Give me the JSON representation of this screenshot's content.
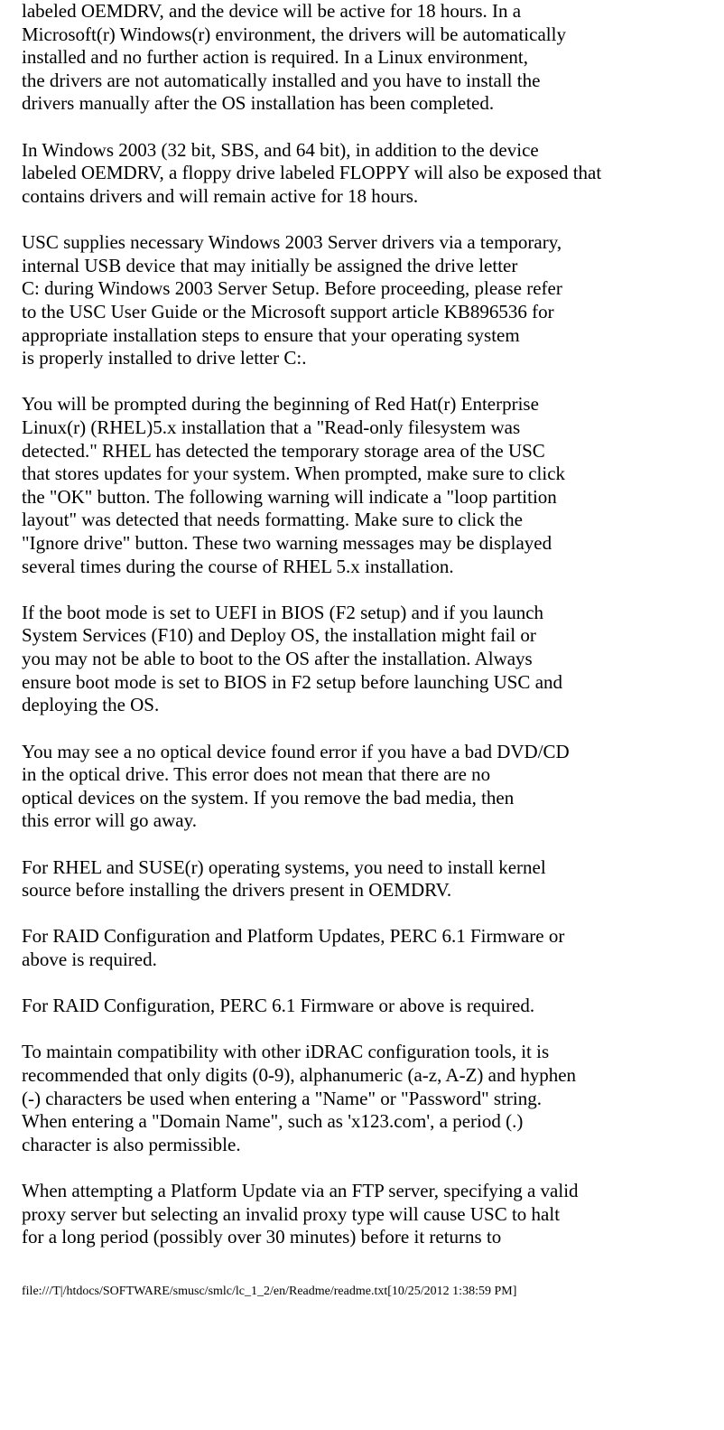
{
  "body_text": "labeled OEMDRV, and the device will be active for 18 hours. In a\nMicrosoft(r) Windows(r) environment, the drivers will be automatically\ninstalled and no further action is required. In a Linux environment,\nthe drivers are not automatically installed and you have to install the\ndrivers manually after the OS installation has been completed.\n\nIn Windows 2003 (32 bit, SBS, and 64 bit), in addition to the device\nlabeled OEMDRV, a floppy drive labeled FLOPPY will also be exposed that\ncontains drivers and will remain active for 18 hours.\n\nUSC supplies necessary Windows 2003 Server drivers via a temporary,\ninternal USB device that may initially be assigned the drive letter\nC: during Windows 2003 Server Setup. Before proceeding, please refer\nto the USC User Guide or the Microsoft support article KB896536 for\nappropriate installation steps to ensure that your operating system\nis properly installed to drive letter C:.\n\nYou will be prompted during the beginning of Red Hat(r) Enterprise\nLinux(r) (RHEL)5.x installation that a \"Read-only filesystem was\ndetected.\" RHEL has detected the temporary storage area of the USC\nthat stores updates for your system. When prompted, make sure to click\nthe \"OK\" button. The following warning will indicate a \"loop partition\nlayout\" was detected that needs formatting. Make sure to click the\n\"Ignore drive\" button. These two warning messages may be displayed\nseveral times during the course of RHEL 5.x installation.\n\nIf the boot mode is set to UEFI in BIOS (F2 setup) and if you launch\nSystem Services (F10) and Deploy OS, the installation might fail or\nyou may not be able to boot to the OS after the installation. Always\nensure boot mode is set to BIOS in F2 setup before launching USC and\ndeploying the OS.\n\nYou may see a no optical device found error if you have a bad DVD/CD\nin the optical drive. This error does not mean that there are no\noptical devices on the system. If you remove the bad media, then\nthis error will go away.\n\nFor RHEL and SUSE(r) operating systems, you need to install kernel\nsource before installing the drivers present in OEMDRV.\n\nFor RAID Configuration and Platform Updates, PERC 6.1 Firmware or\nabove is required.\n\nFor RAID Configuration, PERC 6.1 Firmware or above is required.\n\nTo maintain compatibility with other iDRAC configuration tools, it is\nrecommended that only digits (0-9), alphanumeric (a-z, A-Z) and hyphen\n(-) characters be used when entering a \"Name\" or \"Password\" string.\nWhen entering a \"Domain Name\", such as 'x123.com', a period (.)\ncharacter is also permissible.\n\nWhen attempting a Platform Update via an FTP server, specifying a valid\nproxy server but selecting an invalid proxy type will cause USC to halt\nfor a long period (possibly over 30 minutes) before it returns to",
  "footer_text": "file:///T|/htdocs/SOFTWARE/smusc/smlc/lc_1_2/en/Readme/readme.txt[10/25/2012 1:38:59 PM]"
}
